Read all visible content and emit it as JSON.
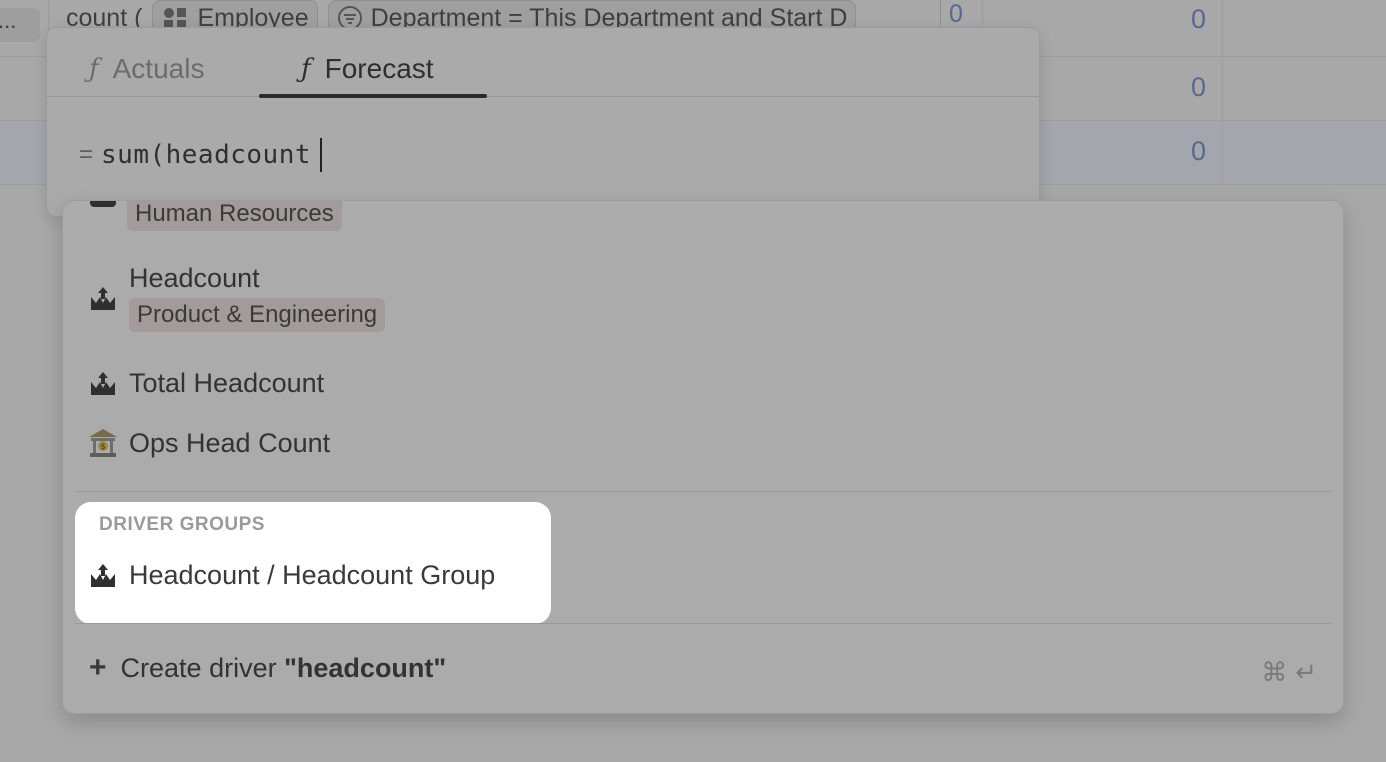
{
  "background": {
    "ellipsis": "...",
    "formula_prefix": "count (",
    "employee_chip": "Employee",
    "filter_chip": "Department = This Department and Start D",
    "zero_cell": "0",
    "row_values": [
      "0",
      "0",
      "0"
    ]
  },
  "editor": {
    "tabs": [
      {
        "label": "Actuals",
        "icon": "function-icon",
        "active": false
      },
      {
        "label": "Forecast",
        "icon": "function-icon",
        "active": true
      }
    ],
    "equals": "=",
    "formula_text": "sum(headcount"
  },
  "dropdown": {
    "cut_item": {
      "department": "Human Resources"
    },
    "items": [
      {
        "label": "Headcount",
        "department": "Product & Engineering",
        "icon": "people-upload-icon"
      },
      {
        "label": "Total Headcount",
        "icon": "people-upload-icon"
      },
      {
        "label": "Ops Head Count",
        "icon": "bank-icon"
      }
    ],
    "groups_heading": "DRIVER GROUPS",
    "group_item": {
      "label": "Headcount / Headcount Group",
      "icon": "people-upload-icon"
    },
    "create": {
      "prefix": "Create driver",
      "query": "\"headcount\"",
      "shortcut_cmd": "⌘",
      "shortcut_enter": "↵"
    }
  },
  "colors": {
    "overlay": "#a8a8a8",
    "highlight": "#ffffff",
    "value_blue": "#596891"
  }
}
